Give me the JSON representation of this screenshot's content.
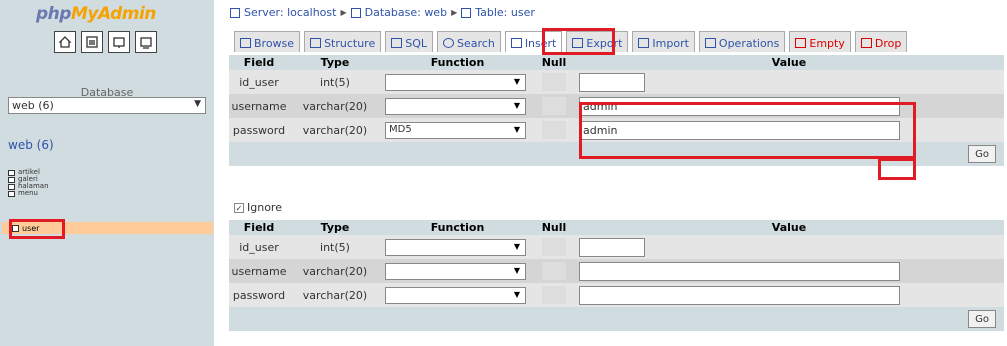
{
  "left": {
    "logo": {
      "php": "php",
      "my": "My",
      "admin": "Admin"
    },
    "icons": [
      "home-icon",
      "query-window-icon",
      "docs-icon",
      "sql-docs-icon"
    ],
    "database_label": "Database",
    "database_select": "web (6)",
    "db_heading": "web",
    "db_count": "(6)",
    "tables": [
      "artikel",
      "galeri",
      "halaman",
      "menu"
    ],
    "selected_table": "user"
  },
  "breadcrumb": {
    "server": "Server: localhost",
    "database": "Database: web",
    "table": "Table: user"
  },
  "tabs": [
    {
      "label": "Browse"
    },
    {
      "label": "Structure"
    },
    {
      "label": "SQL"
    },
    {
      "label": "Search"
    },
    {
      "label": "Insert"
    },
    {
      "label": "Export"
    },
    {
      "label": "Import"
    },
    {
      "label": "Operations"
    },
    {
      "label": "Empty"
    },
    {
      "label": "Drop"
    }
  ],
  "columns": {
    "field": "Field",
    "type": "Type",
    "function": "Function",
    "null": "Null",
    "value": "Value"
  },
  "form1": {
    "rows": [
      {
        "field": "id_user",
        "type": "int(5)",
        "function": "",
        "value": ""
      },
      {
        "field": "username",
        "type": "varchar(20)",
        "function": "",
        "value": "admin"
      },
      {
        "field": "password",
        "type": "varchar(20)",
        "function": "MD5",
        "value": "admin"
      }
    ],
    "go": "Go"
  },
  "ignore_label": "Ignore",
  "form2": {
    "rows": [
      {
        "field": "id_user",
        "type": "int(5)",
        "function": "",
        "value": ""
      },
      {
        "field": "username",
        "type": "varchar(20)",
        "function": "",
        "value": ""
      },
      {
        "field": "password",
        "type": "varchar(20)",
        "function": "",
        "value": ""
      }
    ],
    "go": "Go"
  },
  "colors": {
    "highlight": "#e01b24",
    "frame": "#d0dce0",
    "link": "#2f53a8"
  }
}
